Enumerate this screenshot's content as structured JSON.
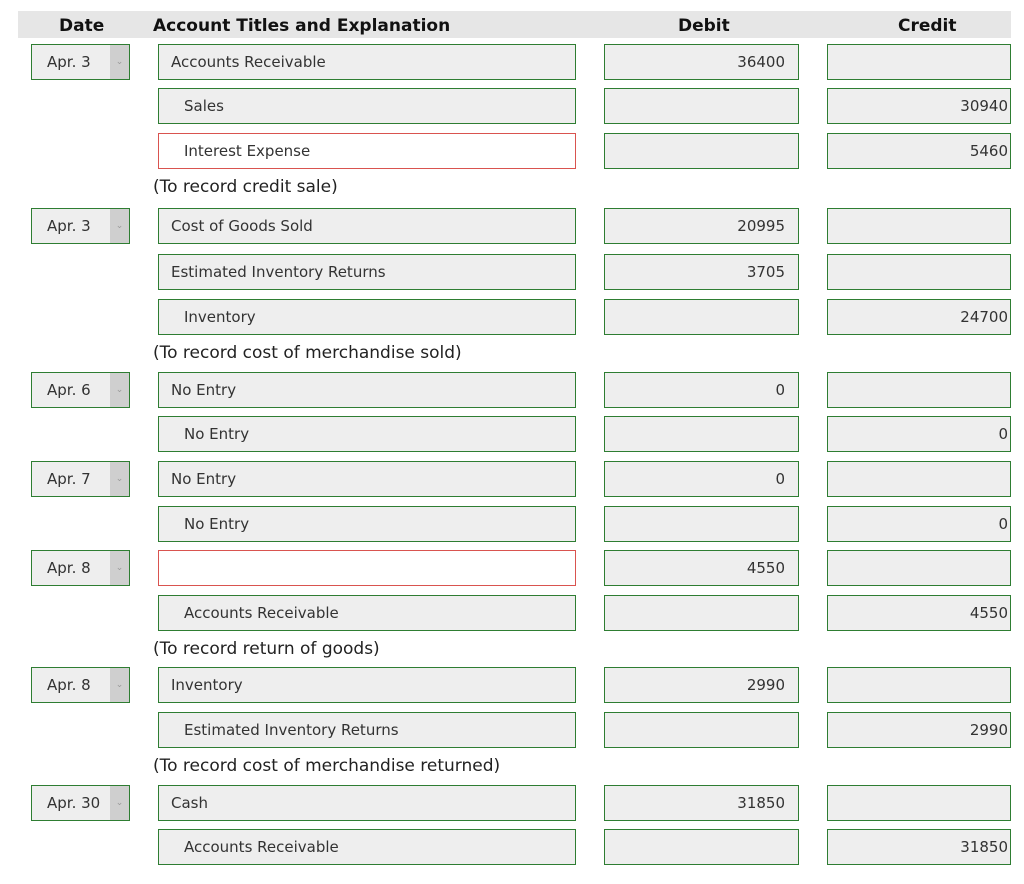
{
  "headers": {
    "date": "Date",
    "account": "Account Titles and Explanation",
    "debit": "Debit",
    "credit": "Credit"
  },
  "rows": [
    {
      "date": "Apr. 3",
      "account": "Accounts Receivable",
      "indent": false,
      "debit": "36400",
      "credit": "",
      "error": false
    },
    {
      "date": "",
      "account": "Sales",
      "indent": true,
      "debit": "",
      "credit": "30940",
      "error": false
    },
    {
      "date": "",
      "account": "Interest Expense",
      "indent": true,
      "debit": "",
      "credit": "5460",
      "error": true
    },
    {
      "date": "Apr. 3",
      "account": "Cost of Goods Sold",
      "indent": false,
      "debit": "20995",
      "credit": "",
      "error": false
    },
    {
      "date": "",
      "account": "Estimated Inventory Returns",
      "indent": false,
      "debit": "3705",
      "credit": "",
      "error": false
    },
    {
      "date": "",
      "account": "Inventory",
      "indent": true,
      "debit": "",
      "credit": "24700",
      "error": false
    },
    {
      "date": "Apr. 6",
      "account": "No Entry",
      "indent": false,
      "debit": "0",
      "credit": "",
      "error": false
    },
    {
      "date": "",
      "account": "No Entry",
      "indent": true,
      "debit": "",
      "credit": "0",
      "error": false
    },
    {
      "date": "Apr. 7",
      "account": "No Entry",
      "indent": false,
      "debit": "0",
      "credit": "",
      "error": false
    },
    {
      "date": "",
      "account": "No Entry",
      "indent": true,
      "debit": "",
      "credit": "0",
      "error": false
    },
    {
      "date": "Apr. 8",
      "account": "",
      "indent": false,
      "debit": "4550",
      "credit": "",
      "error": true
    },
    {
      "date": "",
      "account": "Accounts Receivable",
      "indent": true,
      "debit": "",
      "credit": "4550",
      "error": false
    },
    {
      "date": "Apr. 8",
      "account": "Inventory",
      "indent": false,
      "debit": "2990",
      "credit": "",
      "error": false
    },
    {
      "date": "",
      "account": "Estimated Inventory Returns",
      "indent": true,
      "debit": "",
      "credit": "2990",
      "error": false
    },
    {
      "date": "Apr. 30",
      "account": "Cash",
      "indent": false,
      "debit": "31850",
      "credit": "",
      "error": false
    },
    {
      "date": "",
      "account": "Accounts Receivable",
      "indent": true,
      "debit": "",
      "credit": "31850",
      "error": false
    }
  ],
  "notes": [
    {
      "after_row": 2,
      "text": "(To record credit sale)"
    },
    {
      "after_row": 5,
      "text": "(To record cost of merchandise sold)"
    },
    {
      "after_row": 11,
      "text": "(To record return of goods)"
    },
    {
      "after_row": 13,
      "text": "(To record cost of merchandise returned)"
    }
  ],
  "icons": {
    "date_dropdown": "chevron-down-icon"
  },
  "colors": {
    "valid_border": "#2e7d32",
    "error_border": "#d9534f",
    "field_bg": "#eeeeee",
    "header_bg": "#e6e6e6"
  }
}
